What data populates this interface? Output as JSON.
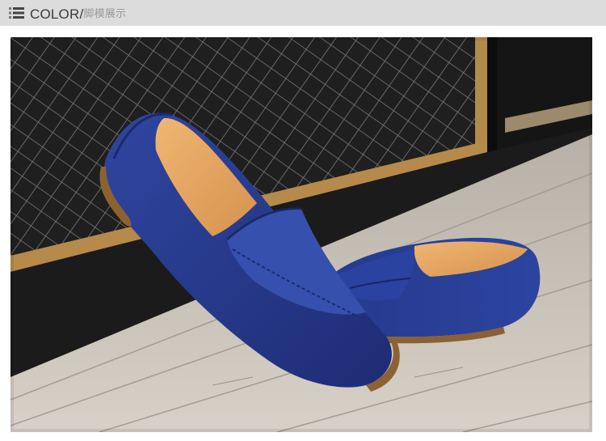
{
  "header": {
    "title_en": "COLOR/",
    "title_zh": "脚模展示",
    "icon": "list-icon"
  },
  "photo": {
    "subject": "blue-suede-loafers",
    "colors": {
      "suede": "#2a3e92",
      "suede_dark": "#1c2a6e",
      "lining": "#e3a663",
      "deck": "#c9c2b8",
      "wall": "#2b2b2b",
      "trim": "#b58a4a"
    }
  }
}
